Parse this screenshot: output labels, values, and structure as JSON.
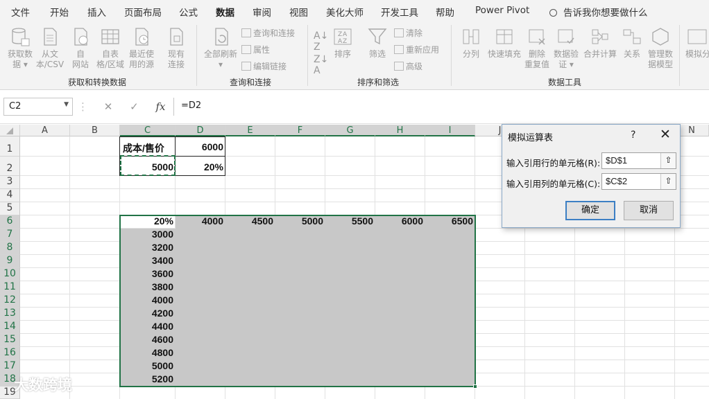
{
  "menu": {
    "tabs": [
      "文件",
      "开始",
      "插入",
      "页面布局",
      "公式",
      "数据",
      "审阅",
      "视图",
      "美化大师",
      "开发工具",
      "帮助",
      "Power Pivot"
    ],
    "active_tab": "数据",
    "tell_me": "告诉我你想要做什么"
  },
  "ribbon": {
    "get_data": [
      "获取数",
      "据 ▾"
    ],
    "from_csv": [
      "从文",
      "本/CSV"
    ],
    "from_web": [
      "自",
      "网站"
    ],
    "from_table": [
      "自表",
      "格/区域"
    ],
    "recent_sources": [
      "最近使",
      "用的源"
    ],
    "existing_connections": [
      "现有",
      "连接"
    ],
    "refresh_all": [
      "全部刷新",
      "▾"
    ],
    "queries_connections": "查询和连接",
    "properties": "属性",
    "edit_links": "编辑链接",
    "sort": "排序",
    "filter": "筛选",
    "clear": "清除",
    "reapply": "重新应用",
    "advanced": "高级",
    "text_to_columns": "分列",
    "flash_fill": "快速填充",
    "remove_duplicates": [
      "删除",
      "重复值"
    ],
    "data_validation": [
      "数据验",
      "证 ▾"
    ],
    "consolidate": "合并计算",
    "relationships": "关系",
    "manage_model": [
      "管理数",
      "据模型"
    ],
    "what_if": [
      "模拟分",
      ""
    ],
    "groups": {
      "get_transform": "获取和转换数据",
      "queries": "查询和连接",
      "sort_filter": "排序和筛选",
      "data_tools": "数据工具"
    }
  },
  "formula_bar": {
    "name_box": "C2",
    "formula": "=D2",
    "fx": "fx"
  },
  "sheet": {
    "columns": [
      "A",
      "B",
      "C",
      "D",
      "E",
      "F",
      "G",
      "H",
      "I",
      "J",
      "N"
    ],
    "rows": [
      "1",
      "2",
      "3",
      "4",
      "5",
      "6",
      "7",
      "8",
      "9",
      "10",
      "11",
      "12",
      "13",
      "14",
      "15",
      "16",
      "17",
      "18",
      "19"
    ],
    "c1": "成本/售价",
    "d1": "6000",
    "c2": "5000",
    "d2": "20%",
    "c6": "20%",
    "header_row": [
      "4000",
      "4500",
      "5000",
      "5500",
      "6000",
      "6500"
    ],
    "first_col": [
      "3000",
      "3200",
      "3400",
      "3600",
      "3800",
      "4000",
      "4200",
      "4400",
      "4600",
      "4800",
      "5000",
      "5200"
    ]
  },
  "dialog": {
    "title": "模拟运算表",
    "help": "?",
    "close": "✕",
    "row_label": "输入引用行的单元格(R):",
    "row_value": "$D$1",
    "col_label": "输入引用列的单元格(C):",
    "col_value": "$C$2",
    "ok": "确定",
    "cancel": "取消"
  },
  "watermark": "大数跨境"
}
